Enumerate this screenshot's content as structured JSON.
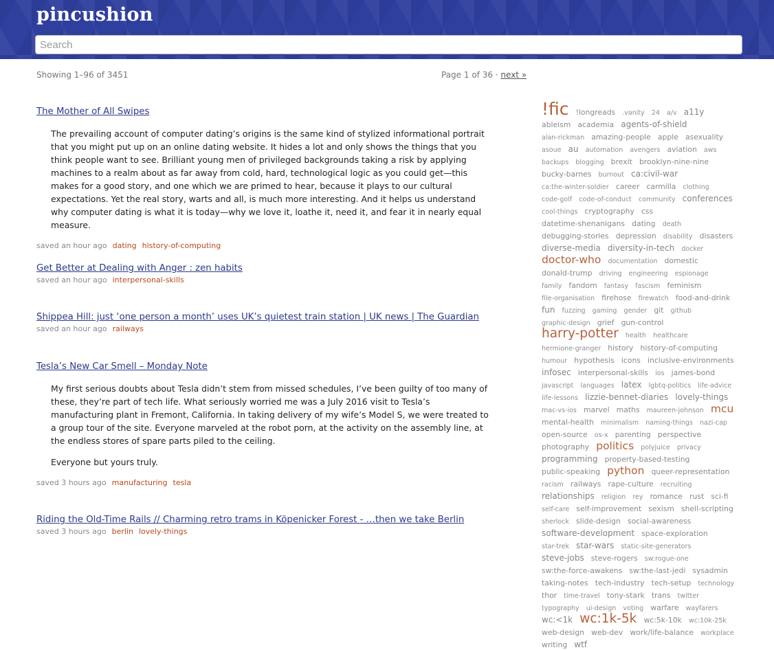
{
  "site": {
    "title": "pincushion"
  },
  "search": {
    "placeholder": "Search"
  },
  "listing": {
    "showing": "Showing 1–96 of 3451",
    "page_label": "Page 1 of 36 · ",
    "next_label": "next »"
  },
  "posts": [
    {
      "title": "The Mother of All Swipes",
      "excerpt": [
        "The prevailing account of computer dating’s origins is the same kind of stylized informational portrait that you might put up on an online dating website. It hides a lot and only shows the things that you think people want to see. Brilliant young men of privileged backgrounds taking a risk by applying machines to a realm about as far away from cold, hard, technological logic as you could get—this makes for a good story, and one which we are primed to hear, because it plays to our cultural expectations. Yet the real story, warts and all, is much more interesting. And it helps us understand why computer dating is what it is today—why we love it, loathe it, need it, and fear it in nearly equal measure."
      ],
      "saved": "saved an hour ago",
      "tags": [
        "dating",
        "history-of-computing"
      ]
    },
    {
      "title": "Get Better at Dealing with Anger : zen habits",
      "excerpt": [],
      "saved": "saved an hour ago",
      "tags": [
        "interpersonal-skills"
      ]
    },
    {
      "title": "Shippea Hill: just ‘one person a month’ uses UK’s quietest train station | UK news | The Guardian",
      "excerpt": [],
      "saved": "saved an hour ago",
      "tags": [
        "railways"
      ]
    },
    {
      "title": "Tesla’s New Car Smell – Monday Note",
      "excerpt": [
        "My first serious doubts about Tesla didn’t stem from missed schedules, I’ve been guilty of too many of these, they’re part of tech life. What seriously worried me was a July 2016 visit to Tesla’s manufacturing plant in Fremont, California. In taking delivery of my wife’s Model S, we were treated to a group tour of the site. Everyone marveled at the robot porn, at the activity on the assembly line, at the endless stores of spare parts piled to the ceiling.",
        "Everyone but yours truly."
      ],
      "saved": "saved 3 hours ago",
      "tags": [
        "manufacturing",
        "tesla"
      ]
    },
    {
      "title": "Riding the Old-Time Rails // Charming retro trams in Köpenicker Forest - …then we take Berlin",
      "excerpt": [],
      "saved": "saved 3 hours ago",
      "tags": [
        "berlin",
        "lovely-things"
      ]
    }
  ],
  "colors": {
    "header_bg": "#2f3f9e",
    "link": "#2b3a8c",
    "tag": "#b8491c",
    "tag_cloud_base": "#8a8a8a",
    "tag_cloud_hot": "#b5613a"
  },
  "tag_cloud": [
    {
      "t": "!fic",
      "w": 5
    },
    {
      "t": "!longreads",
      "w": 1
    },
    {
      "t": ".vanity",
      "w": 0
    },
    {
      "t": "24",
      "w": 0
    },
    {
      "t": "a/v",
      "w": 0
    },
    {
      "t": "a11y",
      "w": 2
    },
    {
      "t": "ableism",
      "w": 1
    },
    {
      "t": "academia",
      "w": 1
    },
    {
      "t": "agents-of-shield",
      "w": 2
    },
    {
      "t": "alan-rickman",
      "w": 0
    },
    {
      "t": "amazing-people",
      "w": 1
    },
    {
      "t": "apple",
      "w": 1
    },
    {
      "t": "asexuality",
      "w": 1
    },
    {
      "t": "asoue",
      "w": 0
    },
    {
      "t": "au",
      "w": 2
    },
    {
      "t": "automation",
      "w": 0
    },
    {
      "t": "avengers",
      "w": 0
    },
    {
      "t": "aviation",
      "w": 1
    },
    {
      "t": "aws",
      "w": 0
    },
    {
      "t": "backups",
      "w": 0
    },
    {
      "t": "blogging",
      "w": 0
    },
    {
      "t": "brexit",
      "w": 1
    },
    {
      "t": "brooklyn-nine-nine",
      "w": 1
    },
    {
      "t": "bucky-barnes",
      "w": 1
    },
    {
      "t": "burnout",
      "w": 0
    },
    {
      "t": "ca:civil-war",
      "w": 2
    },
    {
      "t": "ca:the-winter-soldier",
      "w": 0
    },
    {
      "t": "career",
      "w": 1
    },
    {
      "t": "carmilla",
      "w": 1
    },
    {
      "t": "clothing",
      "w": 0
    },
    {
      "t": "code-golf",
      "w": 0
    },
    {
      "t": "code-of-conduct",
      "w": 0
    },
    {
      "t": "community",
      "w": 0
    },
    {
      "t": "conferences",
      "w": 2
    },
    {
      "t": "cool-things",
      "w": 0
    },
    {
      "t": "cryptography",
      "w": 1
    },
    {
      "t": "css",
      "w": 1
    },
    {
      "t": "datetime-shenanigans",
      "w": 1
    },
    {
      "t": "dating",
      "w": 1
    },
    {
      "t": "death",
      "w": 0
    },
    {
      "t": "debugging-stories",
      "w": 1
    },
    {
      "t": "depression",
      "w": 1
    },
    {
      "t": "disability",
      "w": 0
    },
    {
      "t": "disasters",
      "w": 1
    },
    {
      "t": "diverse-media",
      "w": 2
    },
    {
      "t": "diversity-in-tech",
      "w": 2
    },
    {
      "t": "docker",
      "w": 0
    },
    {
      "t": "doctor-who",
      "w": 3
    },
    {
      "t": "documentation",
      "w": 0
    },
    {
      "t": "domestic",
      "w": 1
    },
    {
      "t": "donald-trump",
      "w": 1
    },
    {
      "t": "driving",
      "w": 0
    },
    {
      "t": "engineering",
      "w": 0
    },
    {
      "t": "espionage",
      "w": 0
    },
    {
      "t": "family",
      "w": 0
    },
    {
      "t": "fandom",
      "w": 1
    },
    {
      "t": "fantasy",
      "w": 0
    },
    {
      "t": "fascism",
      "w": 0
    },
    {
      "t": "feminism",
      "w": 1
    },
    {
      "t": "file-organisation",
      "w": 0
    },
    {
      "t": "firehose",
      "w": 1
    },
    {
      "t": "firewatch",
      "w": 0
    },
    {
      "t": "food-and-drink",
      "w": 1
    },
    {
      "t": "fun",
      "w": 2
    },
    {
      "t": "fuzzing",
      "w": 0
    },
    {
      "t": "gaming",
      "w": 0
    },
    {
      "t": "gender",
      "w": 0
    },
    {
      "t": "git",
      "w": 1
    },
    {
      "t": "github",
      "w": 0
    },
    {
      "t": "graphic-design",
      "w": 0
    },
    {
      "t": "grief",
      "w": 1
    },
    {
      "t": "gun-control",
      "w": 1
    },
    {
      "t": "harry-potter",
      "w": 4
    },
    {
      "t": "health",
      "w": 0
    },
    {
      "t": "healthcare",
      "w": 0
    },
    {
      "t": "hermione-granger",
      "w": 0
    },
    {
      "t": "history",
      "w": 1
    },
    {
      "t": "history-of-computing",
      "w": 1
    },
    {
      "t": "humour",
      "w": 0
    },
    {
      "t": "hypothesis",
      "w": 1
    },
    {
      "t": "icons",
      "w": 1
    },
    {
      "t": "inclusive-environments",
      "w": 1
    },
    {
      "t": "infosec",
      "w": 2
    },
    {
      "t": "interpersonal-skills",
      "w": 1
    },
    {
      "t": "ios",
      "w": 0
    },
    {
      "t": "james-bond",
      "w": 1
    },
    {
      "t": "javascript",
      "w": 0
    },
    {
      "t": "languages",
      "w": 0
    },
    {
      "t": "latex",
      "w": 2
    },
    {
      "t": "lgbtq-politics",
      "w": 0
    },
    {
      "t": "life-advice",
      "w": 0
    },
    {
      "t": "life-lessons",
      "w": 0
    },
    {
      "t": "lizzie-bennet-diaries",
      "w": 2
    },
    {
      "t": "lovely-things",
      "w": 2
    },
    {
      "t": "mac-vs-ios",
      "w": 0
    },
    {
      "t": "marvel",
      "w": 1
    },
    {
      "t": "maths",
      "w": 1
    },
    {
      "t": "maureen-johnson",
      "w": 0
    },
    {
      "t": "mcu",
      "w": 3
    },
    {
      "t": "mental-health",
      "w": 1
    },
    {
      "t": "minimalism",
      "w": 0
    },
    {
      "t": "naming-things",
      "w": 0
    },
    {
      "t": "nazi-cap",
      "w": 0
    },
    {
      "t": "open-source",
      "w": 1
    },
    {
      "t": "os-x",
      "w": 0
    },
    {
      "t": "parenting",
      "w": 1
    },
    {
      "t": "perspective",
      "w": 1
    },
    {
      "t": "photography",
      "w": 1
    },
    {
      "t": "politics",
      "w": 3
    },
    {
      "t": "polyjuice",
      "w": 0
    },
    {
      "t": "privacy",
      "w": 0
    },
    {
      "t": "programming",
      "w": 2
    },
    {
      "t": "property-based-testing",
      "w": 1
    },
    {
      "t": "public-speaking",
      "w": 1
    },
    {
      "t": "python",
      "w": 3
    },
    {
      "t": "queer-representation",
      "w": 1
    },
    {
      "t": "racism",
      "w": 0
    },
    {
      "t": "railways",
      "w": 1
    },
    {
      "t": "rape-culture",
      "w": 1
    },
    {
      "t": "recruiting",
      "w": 0
    },
    {
      "t": "relationships",
      "w": 2
    },
    {
      "t": "religion",
      "w": 0
    },
    {
      "t": "rey",
      "w": 0
    },
    {
      "t": "romance",
      "w": 1
    },
    {
      "t": "rust",
      "w": 1
    },
    {
      "t": "sci-fi",
      "w": 1
    },
    {
      "t": "self-care",
      "w": 0
    },
    {
      "t": "self-improvement",
      "w": 1
    },
    {
      "t": "sexism",
      "w": 1
    },
    {
      "t": "shell-scripting",
      "w": 1
    },
    {
      "t": "sherlock",
      "w": 0
    },
    {
      "t": "slide-design",
      "w": 1
    },
    {
      "t": "social-awareness",
      "w": 1
    },
    {
      "t": "software-development",
      "w": 2
    },
    {
      "t": "space-exploration",
      "w": 1
    },
    {
      "t": "star-trek",
      "w": 0
    },
    {
      "t": "star-wars",
      "w": 2
    },
    {
      "t": "static-site-generators",
      "w": 0
    },
    {
      "t": "steve-jobs",
      "w": 2
    },
    {
      "t": "steve-rogers",
      "w": 1
    },
    {
      "t": "sw:rogue-one",
      "w": 0
    },
    {
      "t": "sw:the-force-awakens",
      "w": 1
    },
    {
      "t": "sw:the-last-jedi",
      "w": 1
    },
    {
      "t": "sysadmin",
      "w": 1
    },
    {
      "t": "taking-notes",
      "w": 1
    },
    {
      "t": "tech-industry",
      "w": 1
    },
    {
      "t": "tech-setup",
      "w": 1
    },
    {
      "t": "technology",
      "w": 0
    },
    {
      "t": "thor",
      "w": 1
    },
    {
      "t": "time-travel",
      "w": 0
    },
    {
      "t": "tony-stark",
      "w": 1
    },
    {
      "t": "trans",
      "w": 1
    },
    {
      "t": "twitter",
      "w": 0
    },
    {
      "t": "typography",
      "w": 0
    },
    {
      "t": "ui-design",
      "w": 0
    },
    {
      "t": "voting",
      "w": 0
    },
    {
      "t": "warfare",
      "w": 1
    },
    {
      "t": "wayfarers",
      "w": 0
    },
    {
      "t": "wc:<1k",
      "w": 2
    },
    {
      "t": "wc:1k-5k",
      "w": 4
    },
    {
      "t": "wc:5k-10k",
      "w": 1
    },
    {
      "t": "wc:10k-25k",
      "w": 0
    },
    {
      "t": "web-design",
      "w": 1
    },
    {
      "t": "web-dev",
      "w": 1
    },
    {
      "t": "work/life-balance",
      "w": 1
    },
    {
      "t": "workplace",
      "w": 0
    },
    {
      "t": "writing",
      "w": 1
    },
    {
      "t": "wtf",
      "w": 2
    }
  ]
}
